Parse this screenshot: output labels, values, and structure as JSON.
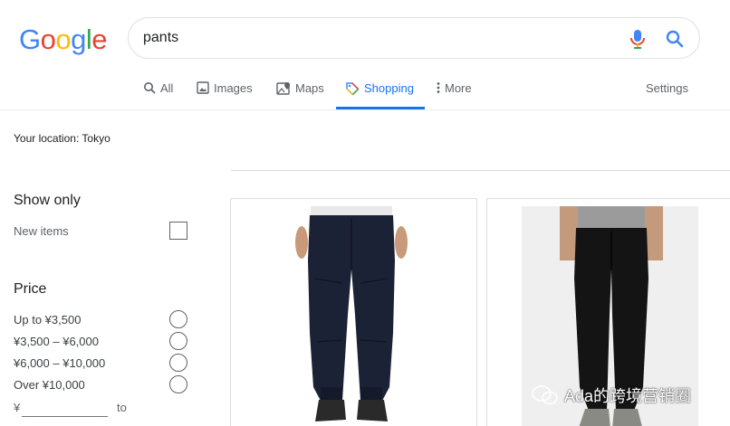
{
  "header": {
    "logo_letters": [
      "G",
      "o",
      "o",
      "g",
      "l",
      "e"
    ],
    "search": {
      "value": "pants"
    }
  },
  "tabs": [
    {
      "label": "All",
      "icon": "search-icon"
    },
    {
      "label": "Images",
      "icon": "image-icon"
    },
    {
      "label": "Maps",
      "icon": "map-icon"
    },
    {
      "label": "Shopping",
      "icon": "tag-icon",
      "active": true
    },
    {
      "label": "More",
      "icon": "more-vert-icon"
    },
    {
      "label": "Settings"
    }
  ],
  "sidebar": {
    "location": "Your location: Tokyo",
    "show_only": {
      "title": "Show only",
      "items": [
        {
          "label": "New items",
          "checked": false
        }
      ]
    },
    "price": {
      "title": "Price",
      "options": [
        "Up to ¥3,500",
        "¥3,500 – ¥6,000",
        "¥6,000 – ¥10,000",
        "Over ¥10,000"
      ],
      "min_prefix": "¥",
      "to_label": "to"
    }
  },
  "results": [
    {
      "product": "navy jogger pants",
      "color": "#1c2236"
    },
    {
      "product": "black tapered pants",
      "color": "#141414"
    }
  ],
  "watermark": "Ada的跨境营销圈",
  "colors": {
    "accent": "#1a73e8",
    "g_blue": "#4285f4",
    "g_red": "#ea4335",
    "g_yellow": "#fbbc05",
    "g_green": "#34a853"
  }
}
